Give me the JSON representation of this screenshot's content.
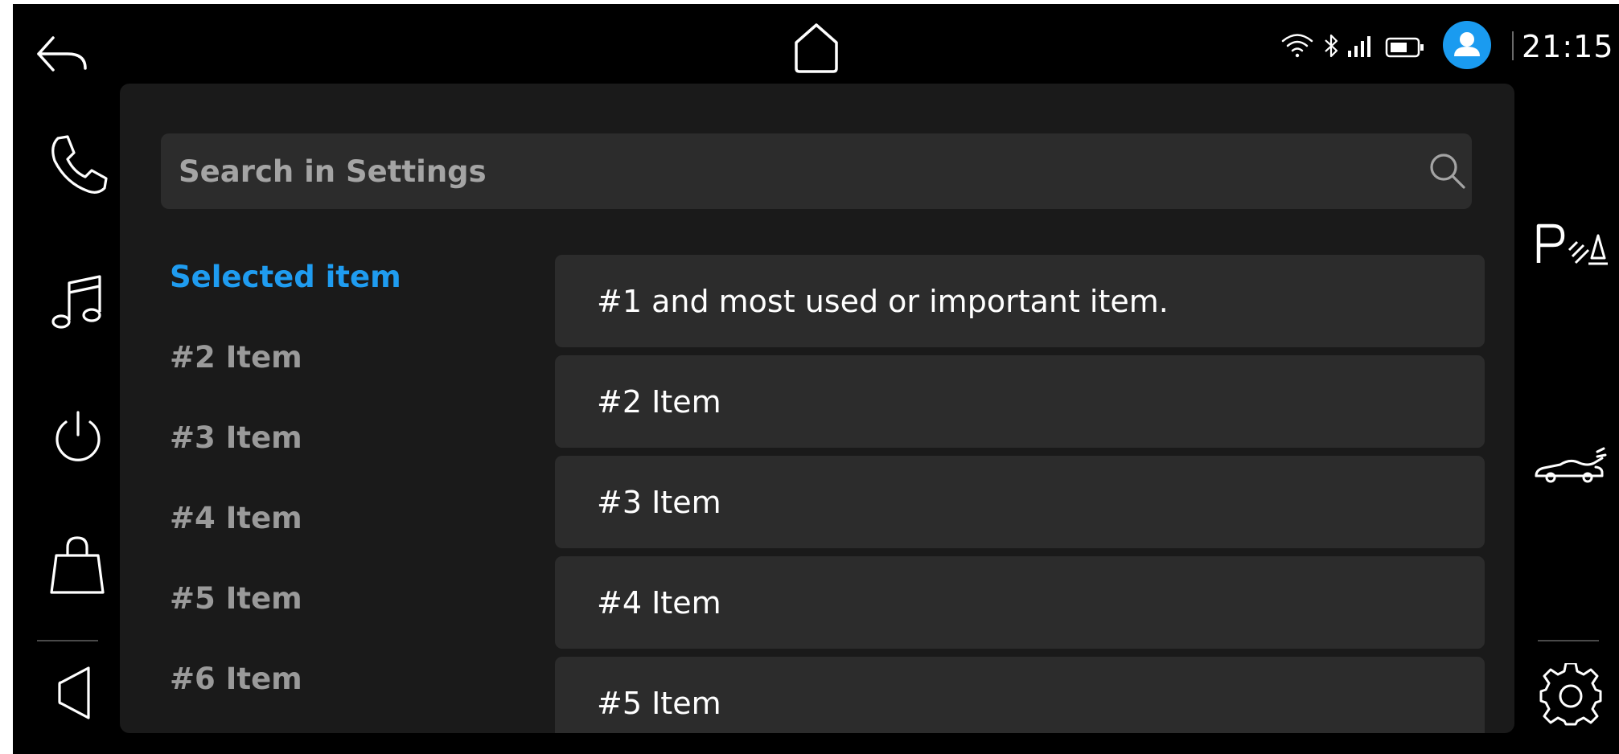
{
  "status_bar": {
    "time": "21:15",
    "accent": "#1a9bf0",
    "icons": [
      "wifi-icon",
      "bluetooth-icon",
      "signal-icon",
      "battery-icon",
      "user-avatar"
    ]
  },
  "nav": {
    "top": [
      "back-icon",
      "home-icon"
    ],
    "left_rail": [
      "phone-icon",
      "music-icon",
      "power-icon",
      "shopping-bag-icon",
      "volume-icon"
    ],
    "right_rail": [
      "park-assist-icon",
      "car-icon",
      "gear-icon"
    ]
  },
  "search": {
    "placeholder": "Search in Settings"
  },
  "categories": [
    {
      "label": "Selected item",
      "selected": true
    },
    {
      "label": "#2 Item"
    },
    {
      "label": "#3 Item"
    },
    {
      "label": "#4 Item"
    },
    {
      "label": "#5 Item"
    },
    {
      "label": "#6 Item"
    }
  ],
  "items": [
    {
      "label": "#1 and most used or important item."
    },
    {
      "label": "#2 Item"
    },
    {
      "label": "#3 Item"
    },
    {
      "label": "#4 Item"
    },
    {
      "label": "#5 Item"
    }
  ]
}
